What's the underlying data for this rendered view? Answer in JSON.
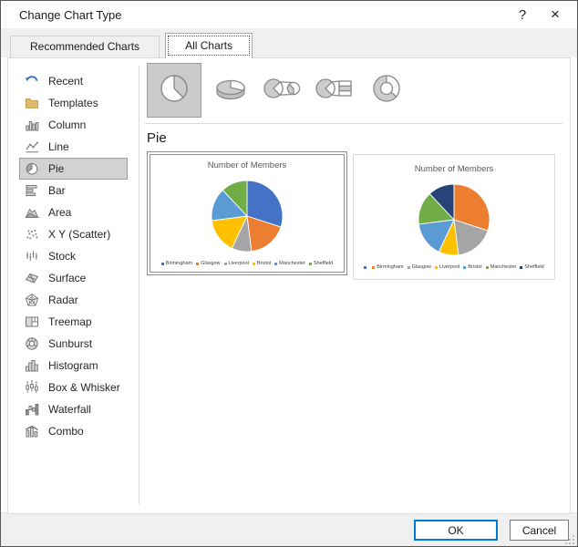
{
  "dialog": {
    "title": "Change Chart Type",
    "help_label": "?",
    "close_label": "×"
  },
  "tabs": [
    {
      "label": "Recommended Charts",
      "active": false
    },
    {
      "label": "All Charts",
      "active": true
    }
  ],
  "sidebar": {
    "items": [
      {
        "label": "Recent",
        "icon": "recent-icon",
        "selected": false
      },
      {
        "label": "Templates",
        "icon": "templates-icon",
        "selected": false
      },
      {
        "label": "Column",
        "icon": "column-chart-icon",
        "selected": false
      },
      {
        "label": "Line",
        "icon": "line-chart-icon",
        "selected": false
      },
      {
        "label": "Pie",
        "icon": "pie-chart-icon",
        "selected": true
      },
      {
        "label": "Bar",
        "icon": "bar-chart-icon",
        "selected": false
      },
      {
        "label": "Area",
        "icon": "area-chart-icon",
        "selected": false
      },
      {
        "label": "X Y (Scatter)",
        "icon": "scatter-chart-icon",
        "selected": false
      },
      {
        "label": "Stock",
        "icon": "stock-chart-icon",
        "selected": false
      },
      {
        "label": "Surface",
        "icon": "surface-chart-icon",
        "selected": false
      },
      {
        "label": "Radar",
        "icon": "radar-chart-icon",
        "selected": false
      },
      {
        "label": "Treemap",
        "icon": "treemap-chart-icon",
        "selected": false
      },
      {
        "label": "Sunburst",
        "icon": "sunburst-chart-icon",
        "selected": false
      },
      {
        "label": "Histogram",
        "icon": "histogram-chart-icon",
        "selected": false
      },
      {
        "label": "Box & Whisker",
        "icon": "box-whisker-chart-icon",
        "selected": false
      },
      {
        "label": "Waterfall",
        "icon": "waterfall-chart-icon",
        "selected": false
      },
      {
        "label": "Combo",
        "icon": "combo-chart-icon",
        "selected": false
      }
    ]
  },
  "subtypes": [
    {
      "icon": "pie-subtype-icon",
      "selected": true
    },
    {
      "icon": "pie-3d-subtype-icon",
      "selected": false
    },
    {
      "icon": "pie-of-pie-subtype-icon",
      "selected": false
    },
    {
      "icon": "bar-of-pie-subtype-icon",
      "selected": false
    },
    {
      "icon": "doughnut-subtype-icon",
      "selected": false
    }
  ],
  "section_heading": "Pie",
  "chart_data": [
    {
      "type": "pie",
      "title": "Number of Members",
      "categories": [
        "Birmingham",
        "Glasgow",
        "Liverpool",
        "Bristol",
        "Manchester",
        "Sheffield"
      ],
      "values": [
        30,
        18,
        9,
        16,
        15,
        12
      ],
      "colors": [
        "#4472C4",
        "#ED7D31",
        "#A5A5A5",
        "#FFC000",
        "#5B9BD5",
        "#70AD47"
      ],
      "legend_position": "bottom",
      "selected": true,
      "legend": [
        {
          "color": "#4472C4",
          "label": "Birmingham"
        },
        {
          "color": "#ED7D31",
          "label": "Glasgow"
        },
        {
          "color": "#A5A5A5",
          "label": "Liverpool"
        },
        {
          "color": "#FFC000",
          "label": "Bristol"
        },
        {
          "color": "#5B9BD5",
          "label": "Manchester"
        },
        {
          "color": "#70AD47",
          "label": "Sheffield"
        }
      ]
    },
    {
      "type": "pie",
      "title": "Number of Members",
      "categories": [
        "Birmingham",
        "Glasgow",
        "Liverpool",
        "Bristol",
        "Manchester",
        "Sheffield"
      ],
      "values": [
        30,
        18,
        9,
        16,
        15,
        12
      ],
      "colors": [
        "#ED7D31",
        "#A5A5A5",
        "#FFC000",
        "#5B9BD5",
        "#70AD47",
        "#264478"
      ],
      "legend_position": "bottom",
      "selected": false,
      "legend": [
        {
          "color": "#4472C4",
          "label": ""
        },
        {
          "color": "#ED7D31",
          "label": "Birmingham"
        },
        {
          "color": "#A5A5A5",
          "label": "Glasgow"
        },
        {
          "color": "#FFC000",
          "label": "Liverpool"
        },
        {
          "color": "#5B9BD5",
          "label": "Bristol"
        },
        {
          "color": "#70AD47",
          "label": "Manchester"
        },
        {
          "color": "#264478",
          "label": "Sheffield"
        }
      ]
    }
  ],
  "footer": {
    "ok_label": "OK",
    "cancel_label": "Cancel"
  },
  "ui_colors": {
    "accent": "#0078D7",
    "selection_fill": "#D2D2D2",
    "selection_border": "#9E9E9E"
  }
}
